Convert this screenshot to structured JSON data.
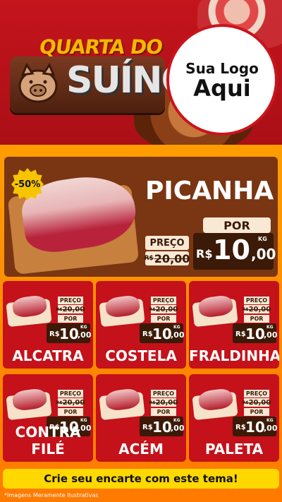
{
  "header": {
    "title_line1": "QUARTA DO",
    "title_line2": "SUÍNO",
    "logo_line1": "Sua Logo",
    "logo_line2": "Aqui"
  },
  "featured": {
    "discount": "-50%",
    "name": "PICANHA",
    "preco_label": "PREÇO",
    "por_label": "POR",
    "old_currency": "R$",
    "old_price": "20,00",
    "currency": "R$",
    "price_int": "10",
    "price_dec": ",00",
    "unit": "KG"
  },
  "products": [
    {
      "name": "ALCATRA",
      "preco_label": "PREÇO",
      "old_currency": "R$",
      "old_price": "20,00",
      "por_label": "POR",
      "currency": "R$",
      "price_int": "10",
      "price_dec": ",00",
      "unit": "KG"
    },
    {
      "name": "COSTELA",
      "preco_label": "PREÇO",
      "old_currency": "R$",
      "old_price": "20,00",
      "por_label": "POR",
      "currency": "R$",
      "price_int": "10",
      "price_dec": ",00",
      "unit": "KG"
    },
    {
      "name": "FRALDINHA",
      "preco_label": "PREÇO",
      "old_currency": "R$",
      "old_price": "20,00",
      "por_label": "POR",
      "currency": "R$",
      "price_int": "10",
      "price_dec": ",00",
      "unit": "KG"
    },
    {
      "name": "CONTRA FILÉ",
      "preco_label": "PREÇO",
      "old_currency": "R$",
      "old_price": "20,00",
      "por_label": "POR",
      "currency": "R$",
      "price_int": "10",
      "price_dec": ",00",
      "unit": "KG"
    },
    {
      "name": "ACÉM",
      "preco_label": "PREÇO",
      "old_currency": "R$",
      "old_price": "20,00",
      "por_label": "POR",
      "currency": "R$",
      "price_int": "10",
      "price_dec": ",00",
      "unit": "KG"
    },
    {
      "name": "PALETA",
      "preco_label": "PREÇO",
      "old_currency": "R$",
      "old_price": "20,00",
      "por_label": "POR",
      "currency": "R$",
      "price_int": "10",
      "price_dec": ",00",
      "unit": "KG"
    }
  ],
  "footer": {
    "cta_label": "Crie seu encarte com este tema!",
    "disclaimer": "*Imagens Meramente Ilustrativas"
  },
  "colors": {
    "brand_red": "#c4111a",
    "orange": "#ff8c00",
    "brown": "#3b1a07",
    "yellow": "#ffd800"
  }
}
